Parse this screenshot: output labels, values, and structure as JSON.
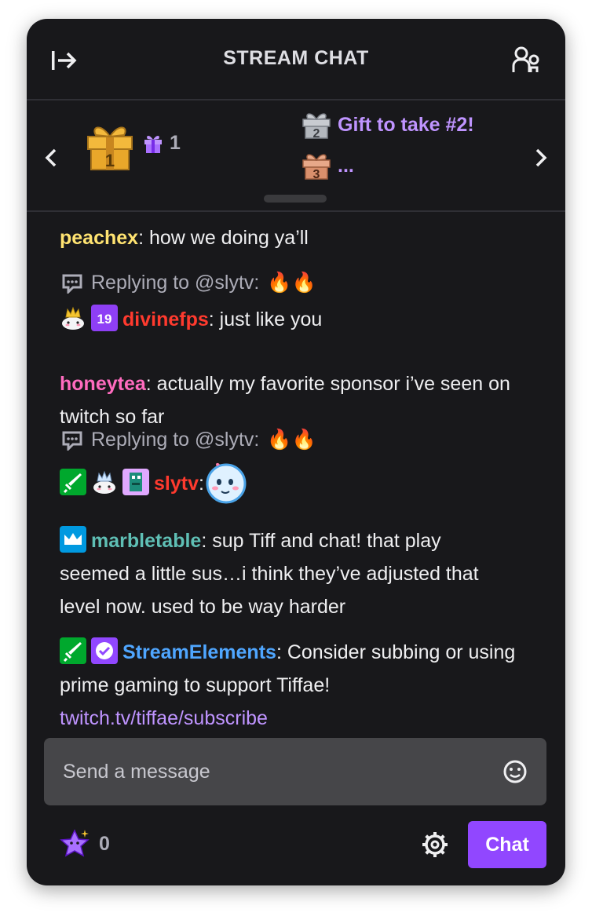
{
  "header": {
    "title": "STREAM CHAT",
    "collapse_icon": "collapse-right-icon",
    "users_icon": "community-users-icon"
  },
  "gifts": {
    "first_place": {
      "rank": "1",
      "icon": "gift-first-icon",
      "count": "1"
    },
    "second_place": {
      "rank": "2",
      "name": "Gift to take #2!"
    },
    "third_place": {
      "rank": "3",
      "name": "..."
    }
  },
  "messages": [
    {
      "user": "peachex",
      "text": "how we doing ya’ll"
    },
    {
      "reply_to": "Replying to @slytv:",
      "reply_emotes": "🔥🔥",
      "user": "divinefps",
      "badges": [
        "crown-cake-badge",
        "nineteen-badge"
      ],
      "text": "just like you"
    },
    {
      "user": "honeytea",
      "text": "actually my favorite sponsor i’ve seen on twitch so far"
    },
    {
      "reply_to": "Replying to @slytv:",
      "reply_emotes": "🔥🔥",
      "user": "slytv",
      "badges": [
        "sword-badge",
        "crown-cake-badge",
        "pixel-badge"
      ],
      "text": ""
    },
    {
      "user": "marbletable",
      "badges": [
        "prime-crown-badge"
      ],
      "text": "sup Tiff and chat! that play seemed a little sus…i think they’ve adjusted that level now. used to be way harder"
    },
    {
      "user": "StreamElements",
      "badges": [
        "sword-badge",
        "verified-badge"
      ],
      "text": "Consider subbing or using prime gaming to support Tiffae!",
      "link": "twitch.tv/tiffae/subscribe"
    }
  ],
  "input": {
    "placeholder": "Send a message"
  },
  "footer": {
    "points": "0",
    "chat_button": "Chat"
  },
  "colors": {
    "background": "#18181b",
    "accent": "#9147ff",
    "peachex": "#ffe371",
    "divinefps": "#ff3a2e",
    "honeytea": "#ff6bbf",
    "slytv": "#ff3a2e",
    "marbletable": "#5fbfb5",
    "StreamElements": "#4fa6ff"
  }
}
